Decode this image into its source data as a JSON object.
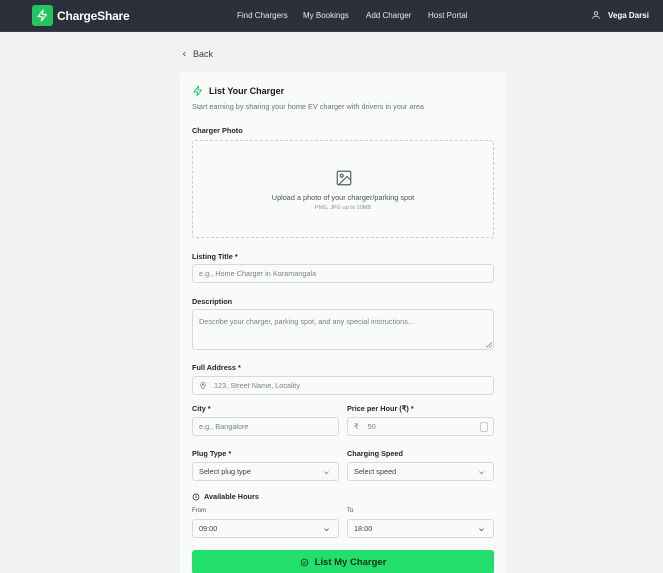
{
  "nav": {
    "brand": "ChargeShare",
    "links": [
      "Find Chargers",
      "My Bookings",
      "Add Charger",
      "Host Portal"
    ],
    "user_name": "Vega Darsi",
    "accent": "#22c55e",
    "bg": "#2b303a"
  },
  "back_label": "Back",
  "form": {
    "title": "List Your Charger",
    "subtitle": "Start earning by sharing your home EV charger with drivers in your area",
    "photo": {
      "label": "Charger Photo",
      "upload_text": "Upload a photo of your charger/parking spot",
      "upload_hint": "PNG, JPG up to 10MB"
    },
    "listing_title": {
      "label": "Listing Title *",
      "placeholder": "e.g., Home Charger in Koramangala"
    },
    "description": {
      "label": "Description",
      "placeholder": "Describe your charger, parking spot, and any special instructions..."
    },
    "address": {
      "label": "Full Address *",
      "placeholder": "123, Street Name, Locality"
    },
    "city": {
      "label": "City *",
      "placeholder": "e.g., Bangalore"
    },
    "price": {
      "label": "Price per Hour (₹) *",
      "currency": "₹",
      "placeholder": "50"
    },
    "plug_type": {
      "label": "Plug Type *",
      "value": "Select plug type"
    },
    "charging_speed": {
      "label": "Charging Speed",
      "value": "Select speed"
    },
    "hours": {
      "label": "Available Hours",
      "from_label": "From",
      "from_value": "09:00",
      "to_label": "To",
      "to_value": "18:00"
    },
    "submit_label": "List My Charger"
  }
}
